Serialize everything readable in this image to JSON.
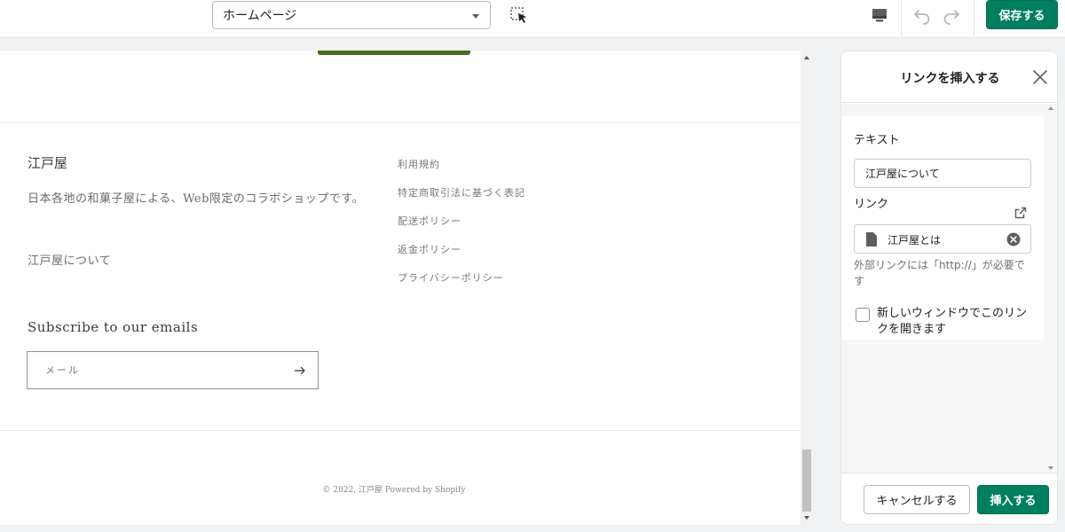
{
  "topbar": {
    "page_select_value": "ホームページ",
    "save_label": "保存する"
  },
  "preview": {
    "shop_name": "江戸屋",
    "shop_description": "日本各地の和菓子屋による、Web限定のコラボショップです。",
    "about_link": "江戸屋について",
    "footer_links": [
      "利用規約",
      "特定商取引法に基づく表記",
      "配送ポリシー",
      "返金ポリシー",
      "プライバシーポリシー"
    ],
    "subscribe_heading": "Subscribe to our emails",
    "email_placeholder": "メール",
    "copyright": "© 2022, 江戸屋 Powered by Shopify"
  },
  "panel": {
    "title": "リンクを挿入する",
    "text_label": "テキスト",
    "text_value": "江戸屋について",
    "link_label": "リンク",
    "link_value": "江戸屋とは",
    "help_text": "外部リンクには「http://」が必要です",
    "new_window_label": "新しいウィンドウでこのリンクを開きます",
    "new_window_checked": false,
    "cancel_label": "キャンセルする",
    "insert_label": "挿入する"
  },
  "colors": {
    "primary": "#007f5f",
    "accent_bar": "#476b1e"
  }
}
